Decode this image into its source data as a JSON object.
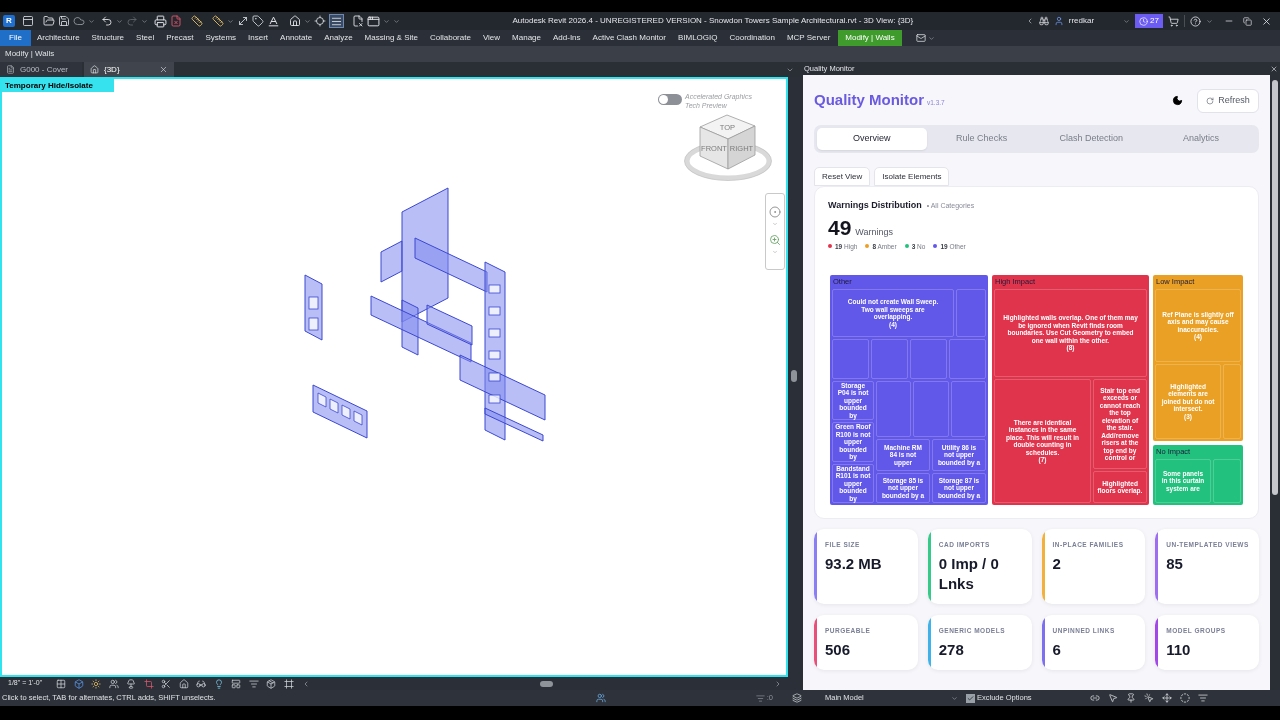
{
  "title_bar": {
    "logo": "R",
    "quick_access": {
      "redo": {
        "disabled": true
      },
      "thin_lines": {
        "on": true
      }
    },
    "title": "Autodesk Revit 2026.4 - UNREGISTERED VERSION - Snowdon Towers Sample Architectural.rvt - 3D View: {3D}",
    "user": "rredkar",
    "trial_days": "27"
  },
  "ribbon_tabs": [
    {
      "label": "File",
      "kind": "application"
    },
    {
      "label": "Architecture",
      "kind": "standard"
    },
    {
      "label": "Structure",
      "kind": "standard"
    },
    {
      "label": "Steel",
      "kind": "standard"
    },
    {
      "label": "Precast",
      "kind": "standard"
    },
    {
      "label": "Systems",
      "kind": "standard"
    },
    {
      "label": "Insert",
      "kind": "standard"
    },
    {
      "label": "Annotate",
      "kind": "standard"
    },
    {
      "label": "Analyze",
      "kind": "standard"
    },
    {
      "label": "Massing & Site",
      "kind": "standard"
    },
    {
      "label": "Collaborate",
      "kind": "standard"
    },
    {
      "label": "View",
      "kind": "standard"
    },
    {
      "label": "Manage",
      "kind": "standard"
    },
    {
      "label": "Add-Ins",
      "kind": "standard"
    },
    {
      "label": "Active Clash Monitor",
      "kind": "standard"
    },
    {
      "label": "BIMLOGIQ",
      "kind": "standard"
    },
    {
      "label": "Coordination",
      "kind": "standard"
    },
    {
      "label": "MCP Server",
      "kind": "standard"
    },
    {
      "label": "Modify | Walls",
      "kind": "contextual"
    }
  ],
  "ribbon_panel": {
    "title": "Modify | Walls"
  },
  "view_tabs": [
    {
      "label": "G000 - Cover",
      "kind": "sheet",
      "selected": false
    },
    {
      "label": "{3D}",
      "kind": "view3d",
      "selected": true
    }
  ],
  "view": {
    "isolate_banner": "Temporary Hide/Isolate",
    "accelerated_graphics": {
      "title": "Accelerated Graphics",
      "subtitle": "Tech Preview",
      "on": false
    },
    "view_cube_faces": [
      "TOP",
      "FRONT",
      "RIGHT"
    ]
  },
  "view_control_bar": {
    "scale": "1/8\" = 1'-0\""
  },
  "quality_monitor": {
    "panel_title": "Quality Monitor",
    "app_title": "Quality Monitor",
    "version": "v1.3.7",
    "refresh_label": "Refresh",
    "tabs": [
      {
        "label": "Overview",
        "selected": true
      },
      {
        "label": "Rule Checks",
        "selected": false
      },
      {
        "label": "Clash Detection",
        "selected": false
      },
      {
        "label": "Analytics",
        "selected": false
      }
    ],
    "actions": [
      "Reset View",
      "Isolate Elements"
    ],
    "warnings": {
      "title": "Warnings Distribution",
      "scope": "• All Categories",
      "total": "49",
      "total_label": "Warnings",
      "legend": [
        {
          "count": "19",
          "label": "High",
          "color": "#e0344c"
        },
        {
          "count": "8",
          "label": "Amber",
          "color": "#eaa024"
        },
        {
          "count": "3",
          "label": "No",
          "color": "#22c27e"
        },
        {
          "count": "19",
          "label": "Other",
          "color": "#6157e8"
        }
      ],
      "treemap": [
        {
          "label": "Other",
          "color": "#6157e8",
          "cells": [
            {
              "kind": "warning",
              "text": "Could not create Wall Sweep. Two wall sweeps are overlapping.",
              "count": "(4)"
            },
            {
              "kind": "blank"
            },
            {
              "kind": "blank"
            },
            {
              "kind": "blank"
            },
            {
              "kind": "blank"
            },
            {
              "kind": "blank"
            },
            {
              "kind": "warning",
              "text": "Storage P04 is not upper bounded by"
            },
            {
              "kind": "blank"
            },
            {
              "kind": "blank"
            },
            {
              "kind": "blank"
            },
            {
              "kind": "warning",
              "text": "Green Roof R100 is not upper bounded by"
            },
            {
              "kind": "warning",
              "text": "Machine RM 84 is not upper"
            },
            {
              "kind": "warning",
              "text": "Utility 86 is not upper bounded by a"
            },
            {
              "kind": "warning",
              "text": "Bandstand R101 is not upper bounded by"
            },
            {
              "kind": "warning",
              "text": "Storage 85 is not upper bounded by a"
            },
            {
              "kind": "warning",
              "text": "Storage 87 is not upper bounded by a"
            }
          ]
        },
        {
          "label": "High Impact",
          "color": "#e0344c",
          "cells": [
            {
              "kind": "warning",
              "text": "Highlighted walls overlap. One of them may be ignored when Revit finds room boundaries. Use Cut Geometry to embed one wall within the other.",
              "count": "(8)"
            },
            {
              "kind": "warning",
              "text": "There are identical instances in the same place. This will result in double counting in schedules.",
              "count": "(7)"
            },
            {
              "kind": "warning",
              "text": "Stair top end exceeds or cannot reach the top elevation of the stair. Add/remove risers at the top end by control or"
            },
            {
              "kind": "warning",
              "text": "Highlighted floors overlap."
            }
          ]
        },
        {
          "label": "Low Impact",
          "color": "#eaa024",
          "cells": [
            {
              "kind": "warning",
              "text": "Ref Plane is slightly off axis and may cause inaccuracies.",
              "count": "(4)"
            },
            {
              "kind": "warning",
              "text": "Highlighted elements are joined but do not intersect.",
              "count": "(3)"
            },
            {
              "kind": "blank"
            }
          ]
        },
        {
          "label": "No Impact",
          "color": "#22c27e",
          "cells": [
            {
              "kind": "warning",
              "text": "Some panels in this curtain system are"
            },
            {
              "kind": "blank"
            }
          ]
        }
      ]
    },
    "metrics": [
      {
        "label": "FILE SIZE",
        "value": "93.2 MB",
        "color": "#8b7ff5"
      },
      {
        "label": "CAD IMPORTS",
        "value": "0 Imp / 0 Lnks",
        "color": "#35c98a"
      },
      {
        "label": "IN-PLACE FAMILIES",
        "value": "2",
        "color": "#f2b13d"
      },
      {
        "label": "UN-TEMPLATED VIEWS",
        "value": "85",
        "color": "#9d6ff0"
      },
      {
        "label": "PURGEABLE",
        "value": "506",
        "color": "#e8507a"
      },
      {
        "label": "GENERIC MODELS",
        "value": "278",
        "color": "#3fb3e9"
      },
      {
        "label": "UNPINNED LINKS",
        "value": "6",
        "color": "#7c6ff0"
      },
      {
        "label": "MODEL GROUPS",
        "value": "110",
        "color": "#a348e8"
      }
    ]
  },
  "status_bar": {
    "prompt": "Click to select, TAB for alternates, CTRL adds, SHIFT unselects.",
    "filter_count": ":0",
    "workset": "Main Model",
    "exclude_options": {
      "label": "Exclude Options",
      "checked": true
    }
  }
}
